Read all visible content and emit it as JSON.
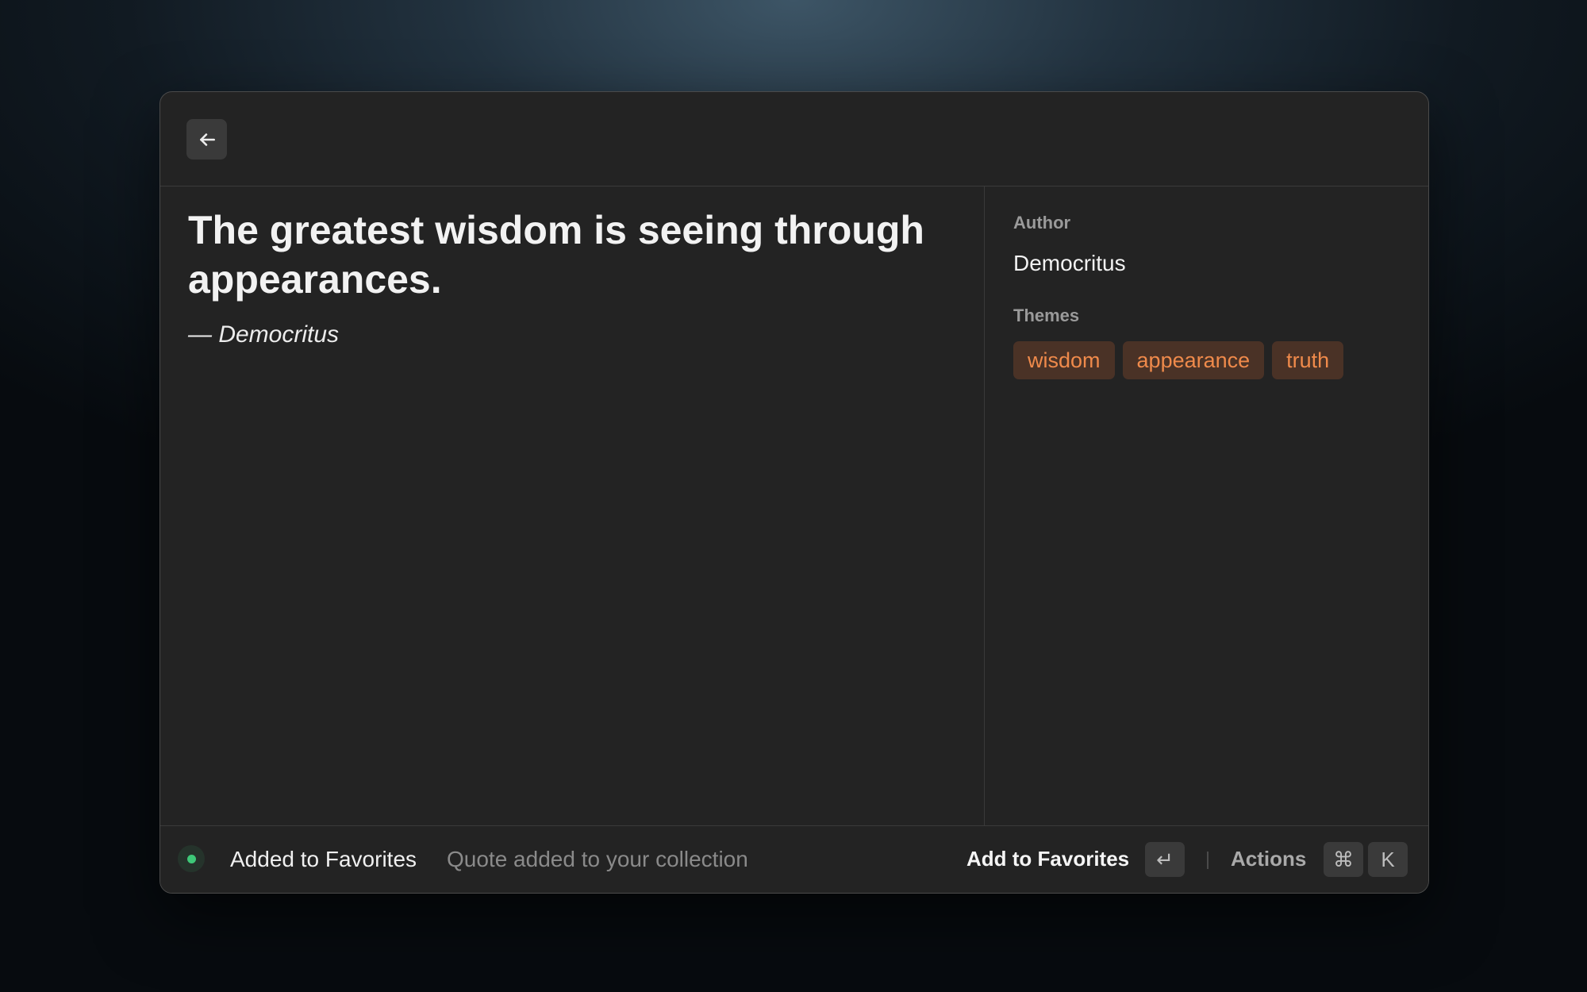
{
  "window": {
    "back_icon": "arrow-left-icon"
  },
  "quote": {
    "text": "The greatest wisdom is seeing through appearances.",
    "attribution": "— Democritus"
  },
  "metadata": {
    "author_label": "Author",
    "author_value": "Democritus",
    "themes_label": "Themes",
    "themes": [
      "wisdom",
      "appearance",
      "truth"
    ],
    "tag_color": "#ef8a4b",
    "tag_background": "#4a3226"
  },
  "footer": {
    "status_color": "#3ec878",
    "toast_title": "Added to Favorites",
    "toast_subtitle": "Quote added to your collection",
    "primary_action": "Add to Favorites",
    "primary_shortcut": "↵",
    "actions_label": "Actions",
    "actions_shortcut": [
      "⌘",
      "K"
    ]
  }
}
